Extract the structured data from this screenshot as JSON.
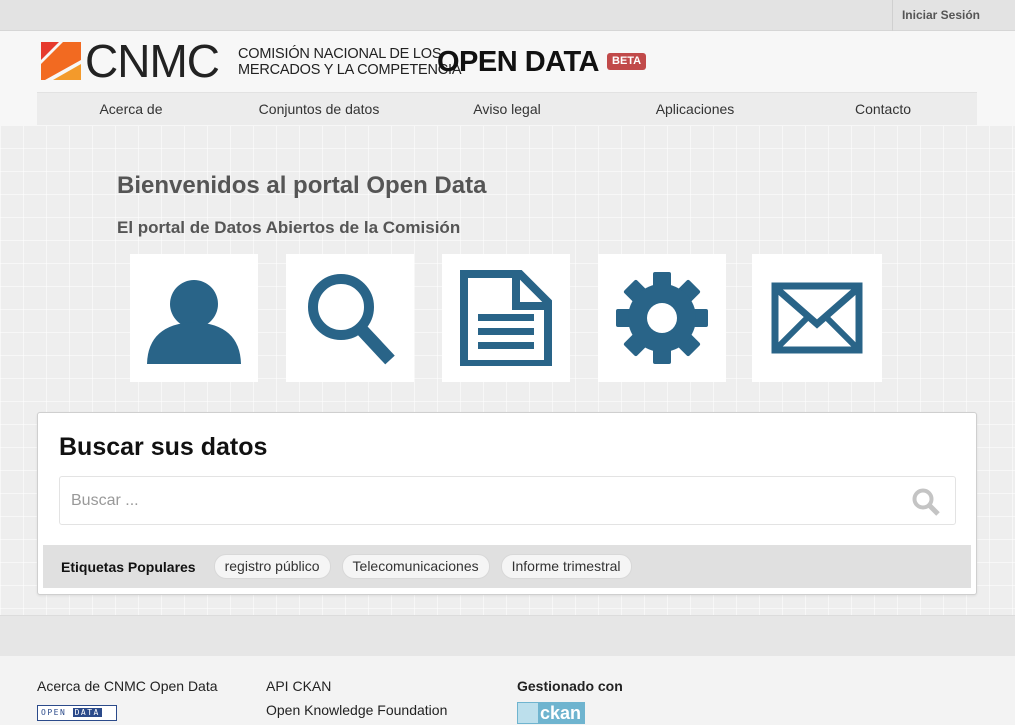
{
  "topbar": {
    "login_label": "Iniciar Sesión"
  },
  "header": {
    "logo_word": "CNMC",
    "logo_line1": "COMISIÓN NACIONAL DE LOS",
    "logo_line2": "MERCADOS Y LA COMPETENCIA",
    "site_title": "OPEN DATA",
    "badge": "BETA"
  },
  "nav": {
    "items": [
      "Acerca de",
      "Conjuntos de datos",
      "Aviso legal",
      "Aplicaciones",
      "Contacto"
    ]
  },
  "hero": {
    "title": "Bienvenidos al portal Open Data",
    "subtitle": "El portal de Datos Abiertos de la Comisión",
    "tiles": [
      "user-icon",
      "search-icon",
      "document-icon",
      "gear-icon",
      "envelope-icon"
    ],
    "icon_color": "#296488"
  },
  "search": {
    "heading": "Buscar sus datos",
    "placeholder": "Buscar ...",
    "tags_label": "Etiquetas Populares",
    "tags": [
      "registro público",
      "Telecomunicaciones",
      "Informe trimestral"
    ]
  },
  "footer": {
    "about": "Acerca de CNMC Open Data",
    "open_data_badge_a": "OPEN",
    "open_data_badge_b": "DATA",
    "api": "API CKAN",
    "okf": "Open Knowledge Foundation",
    "managed": "Gestionado con",
    "ckan": "ckan"
  }
}
